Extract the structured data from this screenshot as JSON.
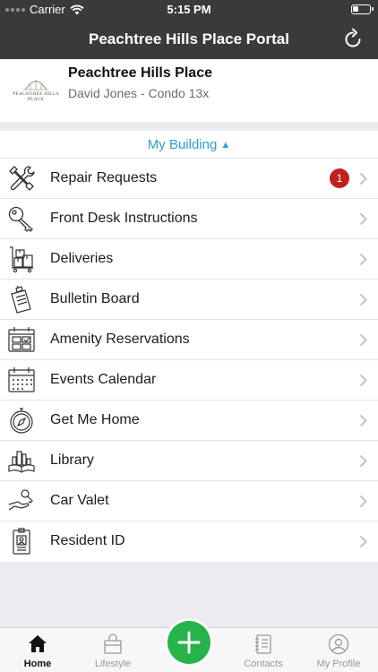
{
  "status_bar": {
    "carrier": "Carrier",
    "time": "5:15 PM"
  },
  "nav": {
    "title": "Peachtree Hills Place Portal",
    "refresh_icon": "refresh-icon"
  },
  "property": {
    "logo_text": "PEACHTREE HILLS PLACE",
    "name": "Peachtree Hills Place",
    "resident": "David Jones - Condo 13x"
  },
  "menu": {
    "header": "My Building",
    "header_caret": "▲",
    "items": [
      {
        "label": "Repair Requests",
        "icon": "tools-icon",
        "badge": "1"
      },
      {
        "label": "Front Desk Instructions",
        "icon": "key-icon"
      },
      {
        "label": "Deliveries",
        "icon": "package-cart-icon"
      },
      {
        "label": "Bulletin Board",
        "icon": "clipboard-icon"
      },
      {
        "label": "Amenity Reservations",
        "icon": "reservation-grid-icon"
      },
      {
        "label": "Events Calendar",
        "icon": "calendar-icon"
      },
      {
        "label": "Get Me Home",
        "icon": "compass-icon"
      },
      {
        "label": "Library",
        "icon": "book-city-icon"
      },
      {
        "label": "Car Valet",
        "icon": "car-key-hand-icon"
      },
      {
        "label": "Resident ID",
        "icon": "id-badge-icon"
      }
    ]
  },
  "tabs": [
    {
      "label": "Home",
      "icon": "home-icon",
      "active": true
    },
    {
      "label": "Lifestyle",
      "icon": "bag-icon"
    },
    {
      "label": "Contacts",
      "icon": "contacts-book-icon"
    },
    {
      "label": "My Profile",
      "icon": "profile-icon"
    }
  ],
  "fab": {
    "icon": "plus-icon"
  },
  "colors": {
    "nav": "#3a3a3c",
    "accent": "#2a9fd6",
    "badge": "#c0211f",
    "fab": "#28b34a"
  }
}
